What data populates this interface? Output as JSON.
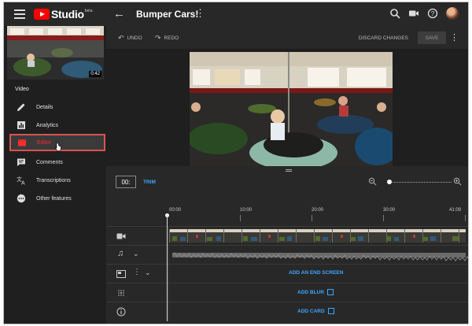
{
  "app": {
    "name": "Studio",
    "badge": "beta"
  },
  "header": {
    "video_title": "Bumper Cars!",
    "back_icon": "back-arrow-icon"
  },
  "sidebar": {
    "thumbnail_duration": "0:42",
    "section_title": "Video",
    "items": [
      {
        "label": "Details",
        "icon": "pencil-icon"
      },
      {
        "label": "Analytics",
        "icon": "bar-chart-icon"
      },
      {
        "label": "Editor",
        "icon": "film-icon",
        "active": true
      },
      {
        "label": "Comments",
        "icon": "comment-icon"
      },
      {
        "label": "Transcriptions",
        "icon": "translate-icon"
      },
      {
        "label": "Other features",
        "icon": "ellipsis-icon"
      }
    ]
  },
  "toolbar": {
    "undo": "UNDO",
    "redo": "REDO",
    "discard": "DISCARD CHANGES",
    "save": "SAVE"
  },
  "timeline": {
    "time_value": "00:",
    "trim_label": "TRIM",
    "zoom_level": 0.04,
    "ticks": [
      "00:00",
      "10:00",
      "20:00",
      "30:00",
      "41:09"
    ],
    "end_screen_label": "ADD AN END SCREEN",
    "blur_label": "ADD BLUR",
    "card_label": "ADD CARD"
  },
  "colors": {
    "accent": "#3ea6ff",
    "brand": "#ff0000",
    "active": "#ff2a2a",
    "highlight_border": "#d9534f"
  }
}
